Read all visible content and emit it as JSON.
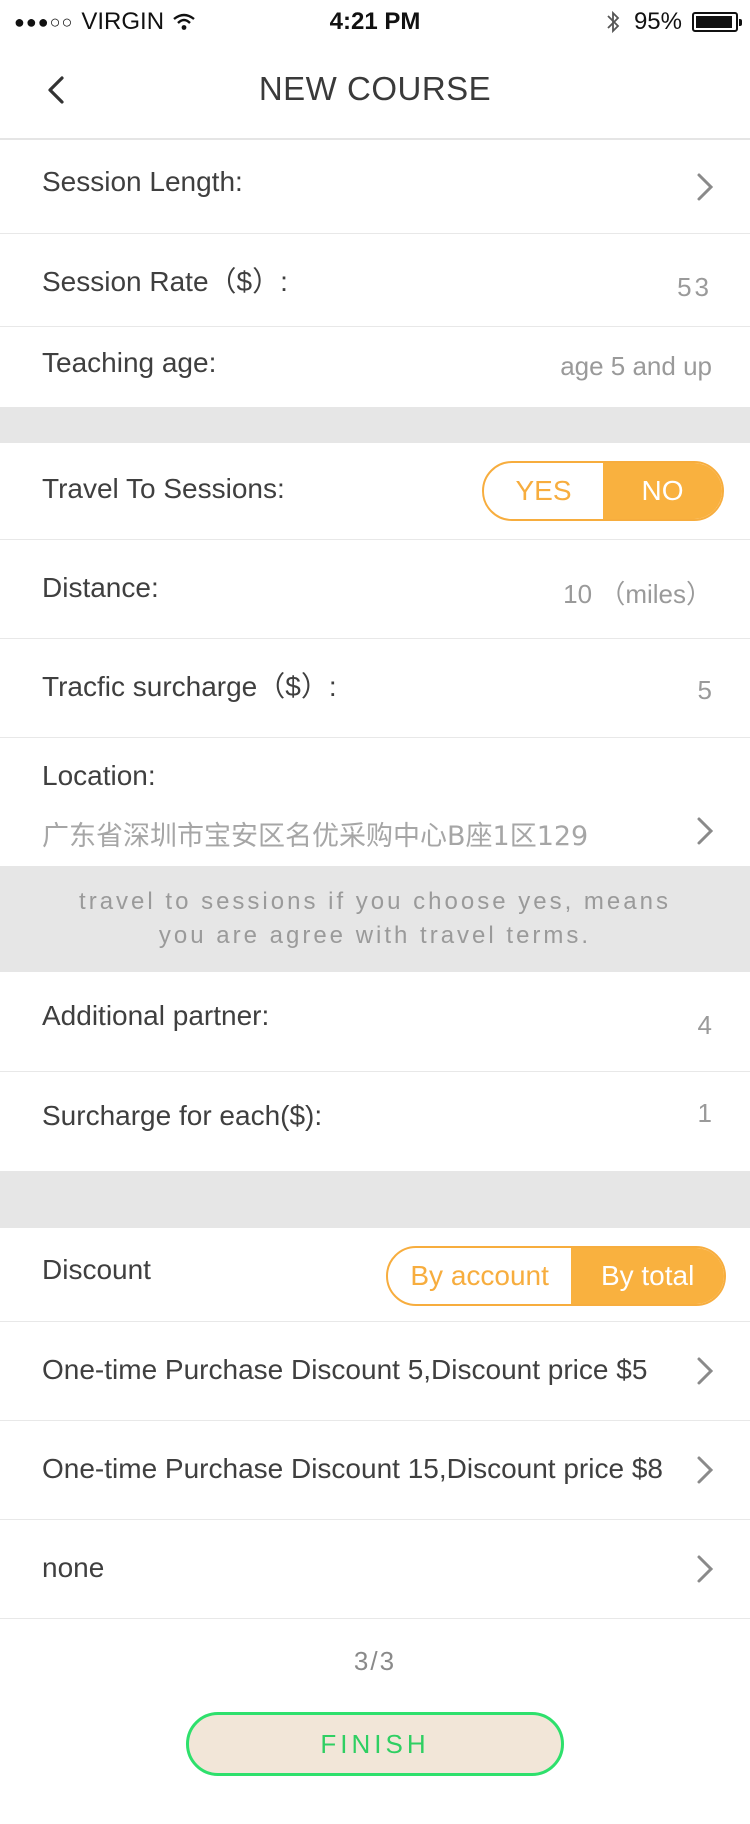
{
  "status_bar": {
    "signal_dots": "●●●○○",
    "carrier": "VIRGIN",
    "time": "4:21 PM",
    "battery": "95%",
    "battery_level": 0.95
  },
  "header": {
    "title": "NEW COURSE",
    "back_icon": "chevron-left-icon"
  },
  "form": {
    "session_length_label": "Session Length:",
    "session_rate_label": "Session Rate（$）:",
    "session_rate_value": "53",
    "teaching_age_label": "Teaching age:",
    "teaching_age_value": "age 5 and up",
    "travel_label": "Travel To Sessions:",
    "travel_options": [
      "YES",
      "NO"
    ],
    "travel_selected": "NO",
    "distance_label": "Distance:",
    "distance_value": "10 （miles）",
    "traffic_label": "Tracfic surcharge（$）:",
    "traffic_value": "5",
    "location_label": "Location:",
    "location_value": "广东省深圳市宝安区名优采购中心B座1区129",
    "note_line1": "travel to sessions if you choose yes, means",
    "note_line2": "you are agree with travel terms.",
    "partner_label": "Additional partner:",
    "partner_value": "4",
    "surcharge_each_label": "Surcharge for each($):",
    "surcharge_each_value": "1",
    "discount_label": "Discount",
    "discount_options": [
      "By account",
      "By total"
    ],
    "discount_selected": "By total",
    "discount_items": [
      "One-time Purchase Discount 5,Discount price $5",
      "One-time Purchase Discount 15,Discount price $8",
      "none"
    ]
  },
  "footer": {
    "pager": "3/3",
    "finish_label": "FINISH"
  },
  "colors": {
    "accent_orange": "#f9b13f",
    "finish_green": "#2ee06c",
    "finish_bg": "#f2e6d8",
    "divider_gray": "#e6e6e6"
  }
}
